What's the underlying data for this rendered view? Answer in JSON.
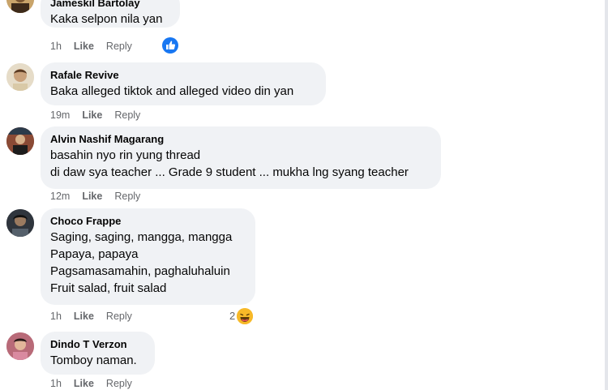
{
  "comments": [
    {
      "author": "Jameskil Bartolay",
      "lines": [
        "Kaka selpon nila yan"
      ],
      "time": "1h",
      "like": "Like",
      "reply": "Reply",
      "reaction": {
        "type": "like-icon",
        "count": "",
        "color": "#1877f2"
      }
    },
    {
      "author": "Rafale Revive",
      "lines": [
        "Baka alleged tiktok and alleged video din yan"
      ],
      "time": "19m",
      "like": "Like",
      "reply": "Reply"
    },
    {
      "author": "Alvin Nashif Magarang",
      "lines": [
        "basahin nyo rin yung thread",
        "di daw sya teacher ... Grade 9 student ... mukha lng syang teacher"
      ],
      "time": "12m",
      "like": "Like",
      "reply": "Reply"
    },
    {
      "author": "Choco Frappe",
      "lines": [
        "Saging, saging, mangga, mangga",
        "Papaya, papaya",
        "Pagsamasamahin, paghaluhaluin",
        "Fruit salad, fruit salad"
      ],
      "time": "1h",
      "like": "Like",
      "reply": "Reply",
      "reaction": {
        "type": "haha-icon",
        "count": "2",
        "color": "#f7b928"
      }
    },
    {
      "author": "Dindo T Verzon",
      "lines": [
        "Tomboy naman."
      ],
      "time": "1h",
      "like": "Like",
      "reply": "Reply"
    }
  ],
  "colors": {
    "bubble": "#f0f2f5",
    "meta": "#65676b",
    "like_blue": "#1877f2"
  }
}
